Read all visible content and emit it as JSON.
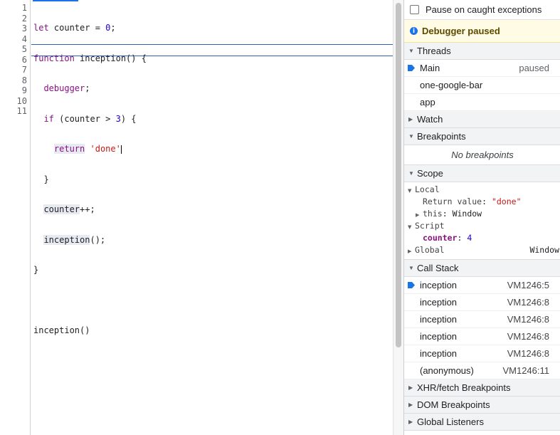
{
  "editor": {
    "line_numbers": [
      "1",
      "2",
      "3",
      "4",
      "5",
      "6",
      "7",
      "8",
      "9",
      "10",
      "11"
    ],
    "current_line": 5
  },
  "sidebar": {
    "pause_on_caught": "Pause on caught exceptions",
    "paused_banner": "Debugger paused",
    "threads": {
      "title": "Threads",
      "items": [
        {
          "name": "Main",
          "status": "paused"
        },
        {
          "name": "one-google-bar",
          "status": ""
        },
        {
          "name": "app",
          "status": ""
        }
      ]
    },
    "watch": {
      "title": "Watch"
    },
    "breakpoints": {
      "title": "Breakpoints",
      "empty": "No breakpoints"
    },
    "scope": {
      "title": "Scope",
      "local": {
        "title": "Local",
        "return_label": "Return value",
        "return_value": "\"done\"",
        "this_label": "this",
        "this_value": "Window"
      },
      "script": {
        "title": "Script",
        "counter_label": "counter",
        "counter_value": "4"
      },
      "global": {
        "title": "Global",
        "value": "Window"
      }
    },
    "call_stack": {
      "title": "Call Stack",
      "frames": [
        {
          "name": "inception",
          "location": "VM1246:5"
        },
        {
          "name": "inception",
          "location": "VM1246:8"
        },
        {
          "name": "inception",
          "location": "VM1246:8"
        },
        {
          "name": "inception",
          "location": "VM1246:8"
        },
        {
          "name": "inception",
          "location": "VM1246:8"
        },
        {
          "name": "(anonymous)",
          "location": "VM1246:11"
        }
      ]
    },
    "xhr": {
      "title": "XHR/fetch Breakpoints"
    },
    "dom": {
      "title": "DOM Breakpoints"
    },
    "global_listeners": {
      "title": "Global Listeners"
    }
  }
}
